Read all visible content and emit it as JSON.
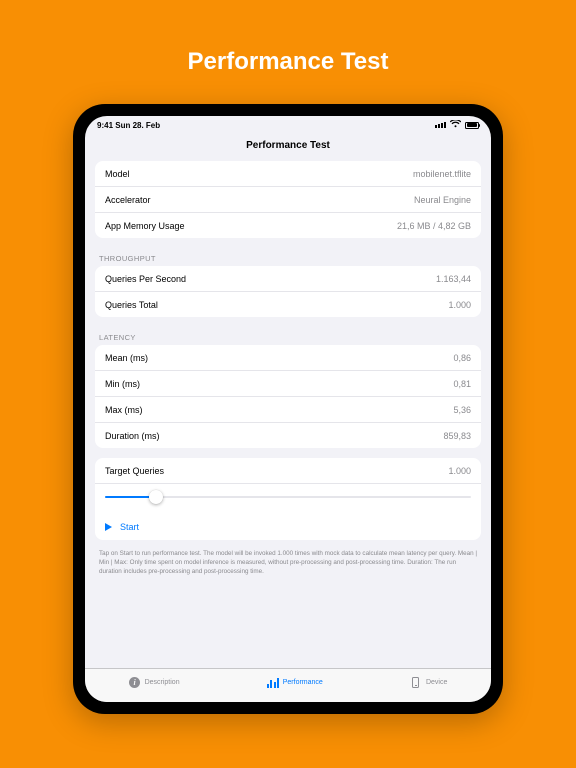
{
  "page_heading": "Performance Test",
  "status_bar": {
    "time": "9:41 Sun 28. Feb"
  },
  "nav_title": "Performance Test",
  "info_group": {
    "model": {
      "label": "Model",
      "value": "mobilenet.tflite"
    },
    "accelerator": {
      "label": "Accelerator",
      "value": "Neural Engine"
    },
    "memory": {
      "label": "App Memory Usage",
      "value": "21,6 MB / 4,82 GB"
    }
  },
  "throughput": {
    "header": "THROUGHPUT",
    "qps": {
      "label": "Queries Per Second",
      "value": "1.163,44"
    },
    "total": {
      "label": "Queries Total",
      "value": "1.000"
    }
  },
  "latency": {
    "header": "LATENCY",
    "mean": {
      "label": "Mean (ms)",
      "value": "0,86"
    },
    "min": {
      "label": "Min (ms)",
      "value": "0,81"
    },
    "max": {
      "label": "Max (ms)",
      "value": "5,36"
    },
    "duration": {
      "label": "Duration (ms)",
      "value": "859,83"
    }
  },
  "controls": {
    "target_queries": {
      "label": "Target Queries",
      "value": "1.000"
    },
    "start": "Start"
  },
  "footnote": "Tap on Start to run performance test. The model will be invoked 1.000 times with mock data to calculate mean latency per query.\nMean | Min | Max: Only time spent on model inference is measured, without pre-processing and post-processing time.\nDuration: The run duration includes pre-processing and post-processing time.",
  "tabs": {
    "description": "Description",
    "performance": "Performance",
    "device": "Device"
  }
}
